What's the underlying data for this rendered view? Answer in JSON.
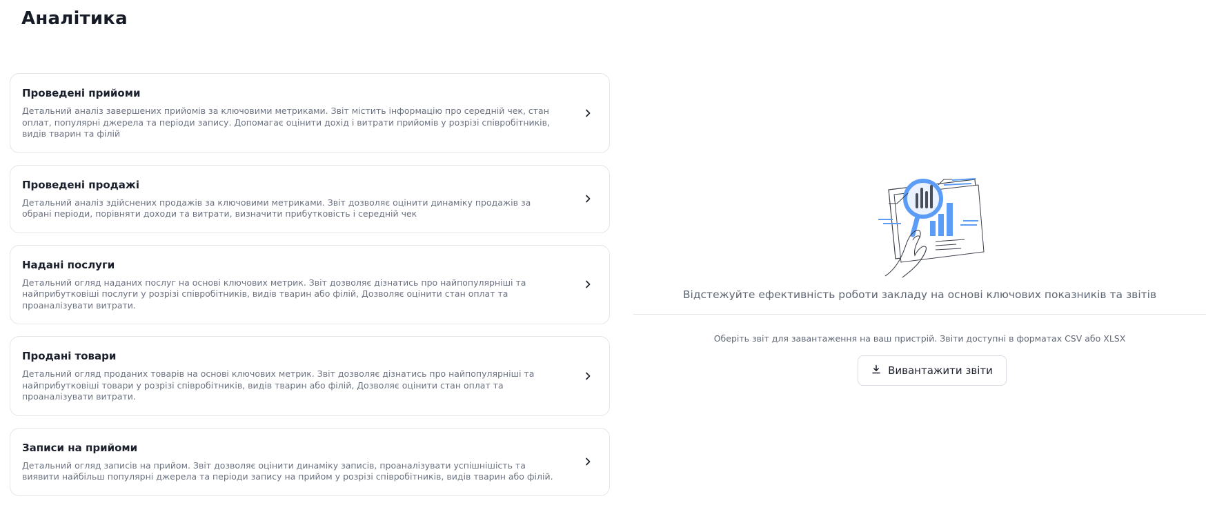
{
  "page": {
    "title": "Аналітика"
  },
  "reports": [
    {
      "title": "Проведені прийоми",
      "description": "Детальний аналіз завершених прийомів за ключовими метриками. Звіт містить інформацію про середній чек, стан оплат, популярні джерела та періоди запису. Допомагає оцінити дохід і витрати прийомів у розрізі співробітників, видів тварин та філій"
    },
    {
      "title": "Проведені продажі",
      "description": "Детальний аналіз здійснених продажів за ключовими метриками. Звіт дозволяє оцінити динаміку продажів за обрані періоди, порівняти доходи та витрати, визначити прибутковість і середній чек"
    },
    {
      "title": "Надані послуги",
      "description": "Детальний огляд наданих послуг на основі ключових метрик. Звіт дозволяє дізнатись про найпопулярніші та найприбутковіші послуги у розрізі співробітників, видів тварин або філій, Дозволяє оцінити стан оплат та проаналізувати витрати."
    },
    {
      "title": "Продані товари",
      "description": "Детальний огляд проданих товарів на основі ключових метрик. Звіт дозволяє дізнатись про найпопулярніші та найприбутковіші товари у розрізі співробітників, видів тварин або філій, Дозволяє оцінити стан оплат та проаналізувати витрати."
    },
    {
      "title": "Записи на прийоми",
      "description": "Детальний огляд записів на прийом. Звіт дозволяє оцінити динаміку записів, проаналізувати успішнішість та виявити найбільш популярні джерела та періоди запису на прийом у розрізі співробітників, видів тварин або філій."
    }
  ],
  "panel": {
    "tagline": "Відстежуйте ефективність роботи закладу на основі ключових показників та звітів",
    "hint": "Оберіть звіт для завантаження на ваш пристрій. Звіти доступні в форматах CSV або XLSX",
    "export_label": "Вивантажити звіти",
    "export_icon": "download-icon",
    "illustration_icon": "analytics-magnifier-illustration"
  },
  "colors": {
    "accent": "#5b9cf6",
    "title": "#161b26",
    "muted": "#6b7280",
    "border": "#e3e5ea"
  }
}
